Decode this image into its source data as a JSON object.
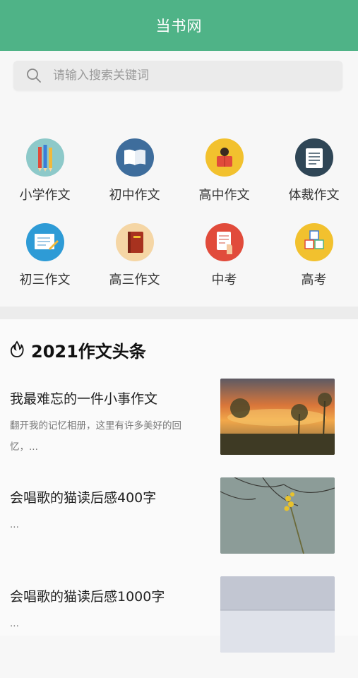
{
  "header": {
    "title": "当书网"
  },
  "search": {
    "placeholder": "请输入搜索关键词"
  },
  "categories": [
    {
      "label": "小学作文",
      "icon": "pencils-icon"
    },
    {
      "label": "初中作文",
      "icon": "open-book-icon"
    },
    {
      "label": "高中作文",
      "icon": "student-reading-icon"
    },
    {
      "label": "体裁作文",
      "icon": "notepad-icon"
    },
    {
      "label": "初三作文",
      "icon": "document-edit-icon"
    },
    {
      "label": "高三作文",
      "icon": "closed-book-icon"
    },
    {
      "label": "中考",
      "icon": "exam-paper-icon"
    },
    {
      "label": "高考",
      "icon": "abc-blocks-icon"
    }
  ],
  "feed": {
    "title": "2021作文头条",
    "articles": [
      {
        "title": "我最难忘的一件小事作文",
        "desc": "翻开我的记忆相册，这里有许多美好的回忆，..."
      },
      {
        "title": "会唱歌的猫读后感400字",
        "desc": "..."
      },
      {
        "title": "会唱歌的猫读后感1000字",
        "desc": "..."
      }
    ]
  },
  "colors": {
    "brand": "#4fb387"
  }
}
